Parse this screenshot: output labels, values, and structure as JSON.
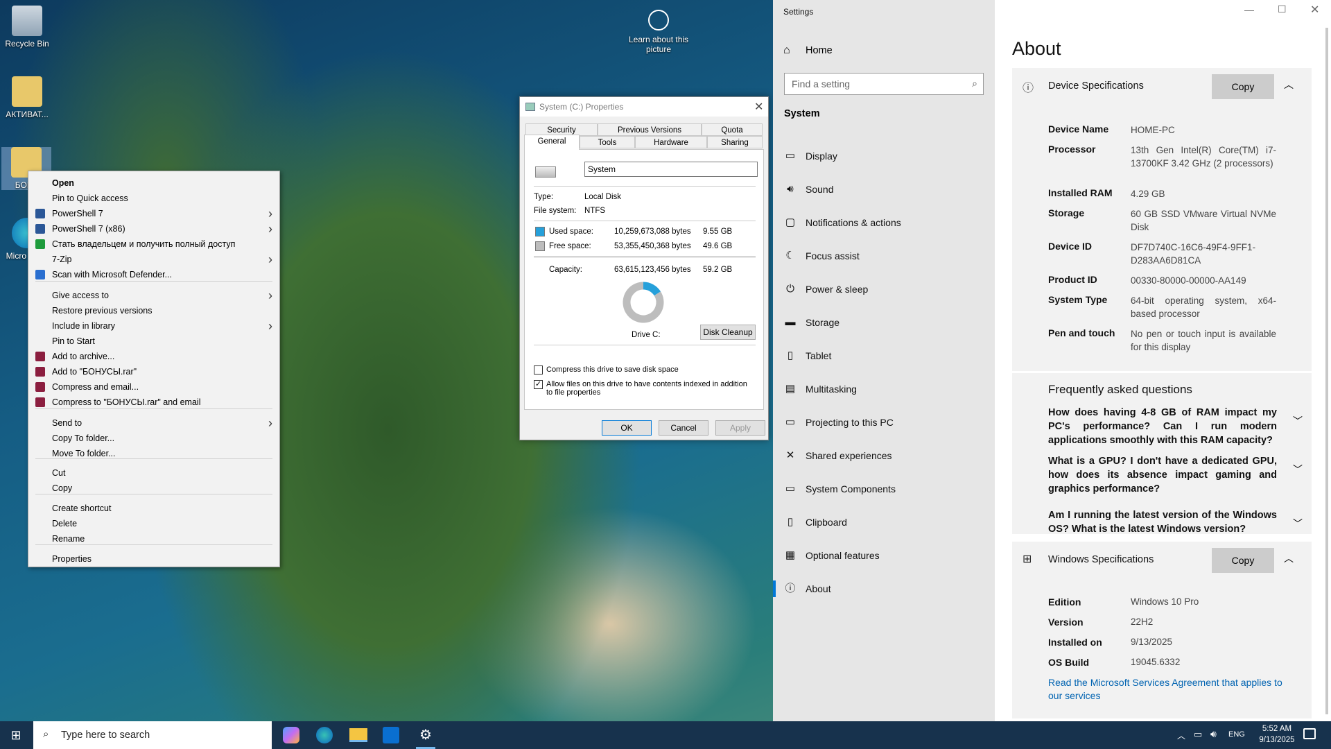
{
  "desktop": {
    "icons": [
      "Recycle Bin",
      "АКТИВАТ...",
      "БОН..",
      "Micro Edg.."
    ],
    "learn": "Learn about this picture"
  },
  "context_menu": {
    "items": [
      {
        "label": "Open",
        "bold": true
      },
      {
        "label": "Pin to Quick access"
      },
      {
        "label": "PowerShell 7",
        "sub": true
      },
      {
        "label": "PowerShell 7 (x86)",
        "sub": true
      },
      {
        "label": "Стать владельцем и получить полный доступ"
      },
      {
        "label": "7-Zip",
        "sub": true
      },
      {
        "label": "Scan with Microsoft Defender..."
      },
      {
        "label": "Give access to",
        "sub": true
      },
      {
        "label": "Restore previous versions"
      },
      {
        "label": "Include in library",
        "sub": true
      },
      {
        "label": "Pin to Start"
      },
      {
        "label": "Add to archive..."
      },
      {
        "label": "Add to \"БОНУСЫ.rar\""
      },
      {
        "label": "Compress and email..."
      },
      {
        "label": "Compress to \"БОНУСЫ.rar\" and email"
      },
      {
        "label": "Send to",
        "sub": true
      },
      {
        "label": "Copy To folder..."
      },
      {
        "label": "Move To folder..."
      },
      {
        "label": "Cut"
      },
      {
        "label": "Copy"
      },
      {
        "label": "Create shortcut"
      },
      {
        "label": "Delete"
      },
      {
        "label": "Rename"
      },
      {
        "label": "Properties"
      }
    ]
  },
  "props": {
    "title": "System (C:) Properties",
    "tabs": [
      "Security",
      "Previous Versions",
      "Quota",
      "General",
      "Tools",
      "Hardware",
      "Sharing"
    ],
    "name": "System",
    "type_label": "Type:",
    "type": "Local Disk",
    "fs_label": "File system:",
    "fs": "NTFS",
    "used_label": "Used space:",
    "used_bytes": "10,259,673,088 bytes",
    "used_gb": "9.55 GB",
    "free_label": "Free space:",
    "free_bytes": "53,355,450,368 bytes",
    "free_gb": "49.6 GB",
    "cap_label": "Capacity:",
    "cap_bytes": "63,615,123,456 bytes",
    "cap_gb": "59.2 GB",
    "drive": "Drive C:",
    "cleanup": "Disk Cleanup",
    "compress": "Compress this drive to save disk space",
    "index": "Allow files on this drive to have contents indexed in addition to file properties",
    "ok": "OK",
    "cancel": "Cancel",
    "apply": "Apply"
  },
  "settings": {
    "app": "Settings",
    "home": "Home",
    "search_ph": "Find a setting",
    "section": "System",
    "nav": [
      "Display",
      "Sound",
      "Notifications & actions",
      "Focus assist",
      "Power & sleep",
      "Storage",
      "Tablet",
      "Multitasking",
      "Projecting to this PC",
      "Shared experiences",
      "System Components",
      "Clipboard",
      "Optional features",
      "About"
    ],
    "page_title": "About",
    "dev_spec": "Device Specifications",
    "copy": "Copy",
    "specs": [
      {
        "k": "Device Name",
        "v": "HOME-PC"
      },
      {
        "k": "Processor",
        "v": "13th Gen Intel(R) Core(TM) i7-13700KF 3.42 GHz (2 processors)"
      },
      {
        "k": "Installed RAM",
        "v": "4.29 GB"
      },
      {
        "k": "Storage",
        "v": "60 GB SSD VMware Virtual NVMe Disk"
      },
      {
        "k": "Device ID",
        "v": "DF7D740C-16C6-49F4-9FF1-D283AA6D81CA"
      },
      {
        "k": "Product ID",
        "v": "00330-80000-00000-AA149"
      },
      {
        "k": "System Type",
        "v": "64-bit operating system, x64-based processor"
      },
      {
        "k": "Pen and touch",
        "v": "No pen or touch input is available for this display"
      }
    ],
    "faq_title": "Frequently asked questions",
    "faq": [
      "How does having 4-8 GB of RAM impact my PC's performance? Can I run modern applications smoothly with this RAM capacity?",
      "What is a GPU? I don't have a dedicated GPU, how does its absence impact gaming and graphics performance?",
      "Am I running the latest version of the Windows OS? What is the latest Windows version?"
    ],
    "win_spec": "Windows Specifications",
    "win": [
      {
        "k": "Edition",
        "v": "Windows 10 Pro"
      },
      {
        "k": "Version",
        "v": "22H2"
      },
      {
        "k": "Installed on",
        "v": "9/13/2025"
      },
      {
        "k": "OS Build",
        "v": "19045.6332"
      }
    ],
    "msa": "Read the Microsoft Services Agreement that applies to our services"
  },
  "taskbar": {
    "search_ph": "Type here to search",
    "lang": "ENG",
    "time": "5:52 AM",
    "date": "9/13/2025"
  },
  "chart_data": {
    "type": "pie",
    "categories": [
      "Used space",
      "Free space"
    ],
    "values": [
      9.55,
      49.6
    ]
  }
}
